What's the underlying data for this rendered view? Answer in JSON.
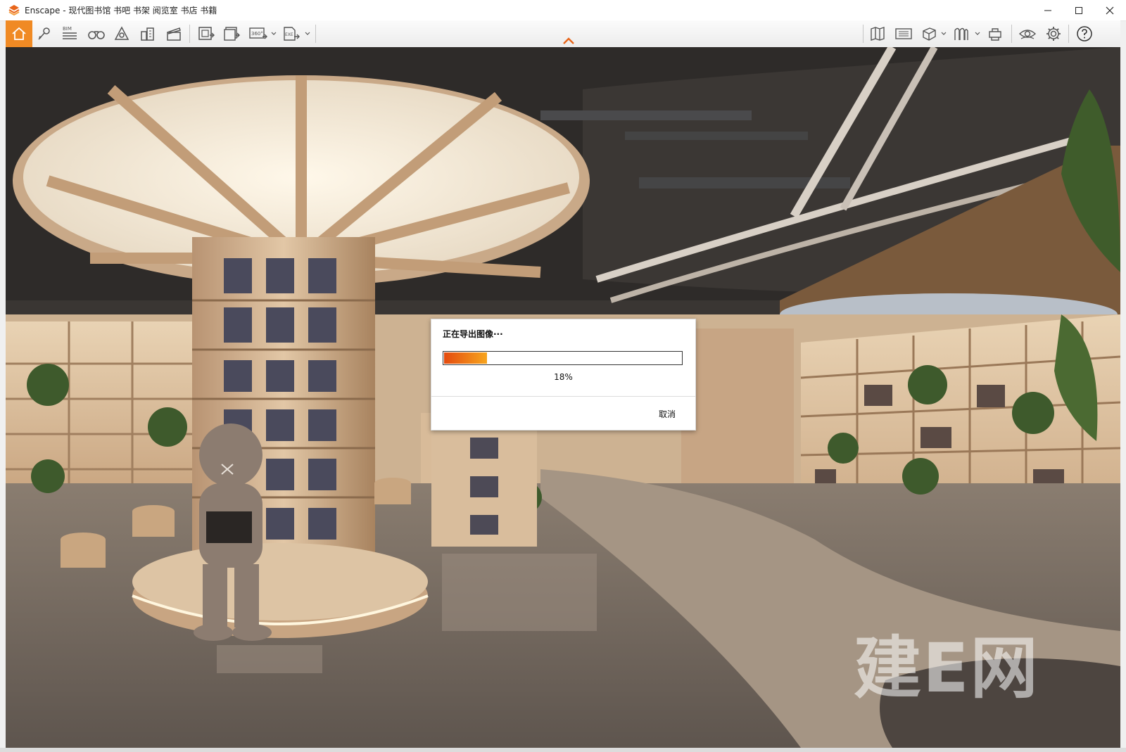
{
  "window": {
    "title": "Enscape - 现代图书馆 书吧 书架 阅览室 书店 书籍",
    "controls": [
      "minimize-icon",
      "maximize-icon",
      "close-icon"
    ]
  },
  "toolbar": {
    "left_icons": [
      "home-icon",
      "location-pin-icon",
      "bim-icon",
      "binoculars-icon",
      "vr-headset-icon",
      "buildings-icon",
      "clapperboard-icon",
      "screenshot-icon",
      "batch-render-icon",
      "panorama-360-icon",
      "exe-export-icon"
    ],
    "bim_label": "BIM",
    "pano_label": "360°",
    "exe_label": "EXE",
    "right_icons": [
      "map-icon",
      "asset-library-icon",
      "cube-icon",
      "material-icon",
      "upload-icon",
      "visual-settings-icon",
      "gear-icon",
      "help-icon"
    ],
    "accent": "#f08a24"
  },
  "viewport": {
    "watermark": "建E网"
  },
  "dialog": {
    "title": "正在导出图像···",
    "progress": 0.18,
    "progress_label": "18%",
    "cancel_label": "取消"
  }
}
